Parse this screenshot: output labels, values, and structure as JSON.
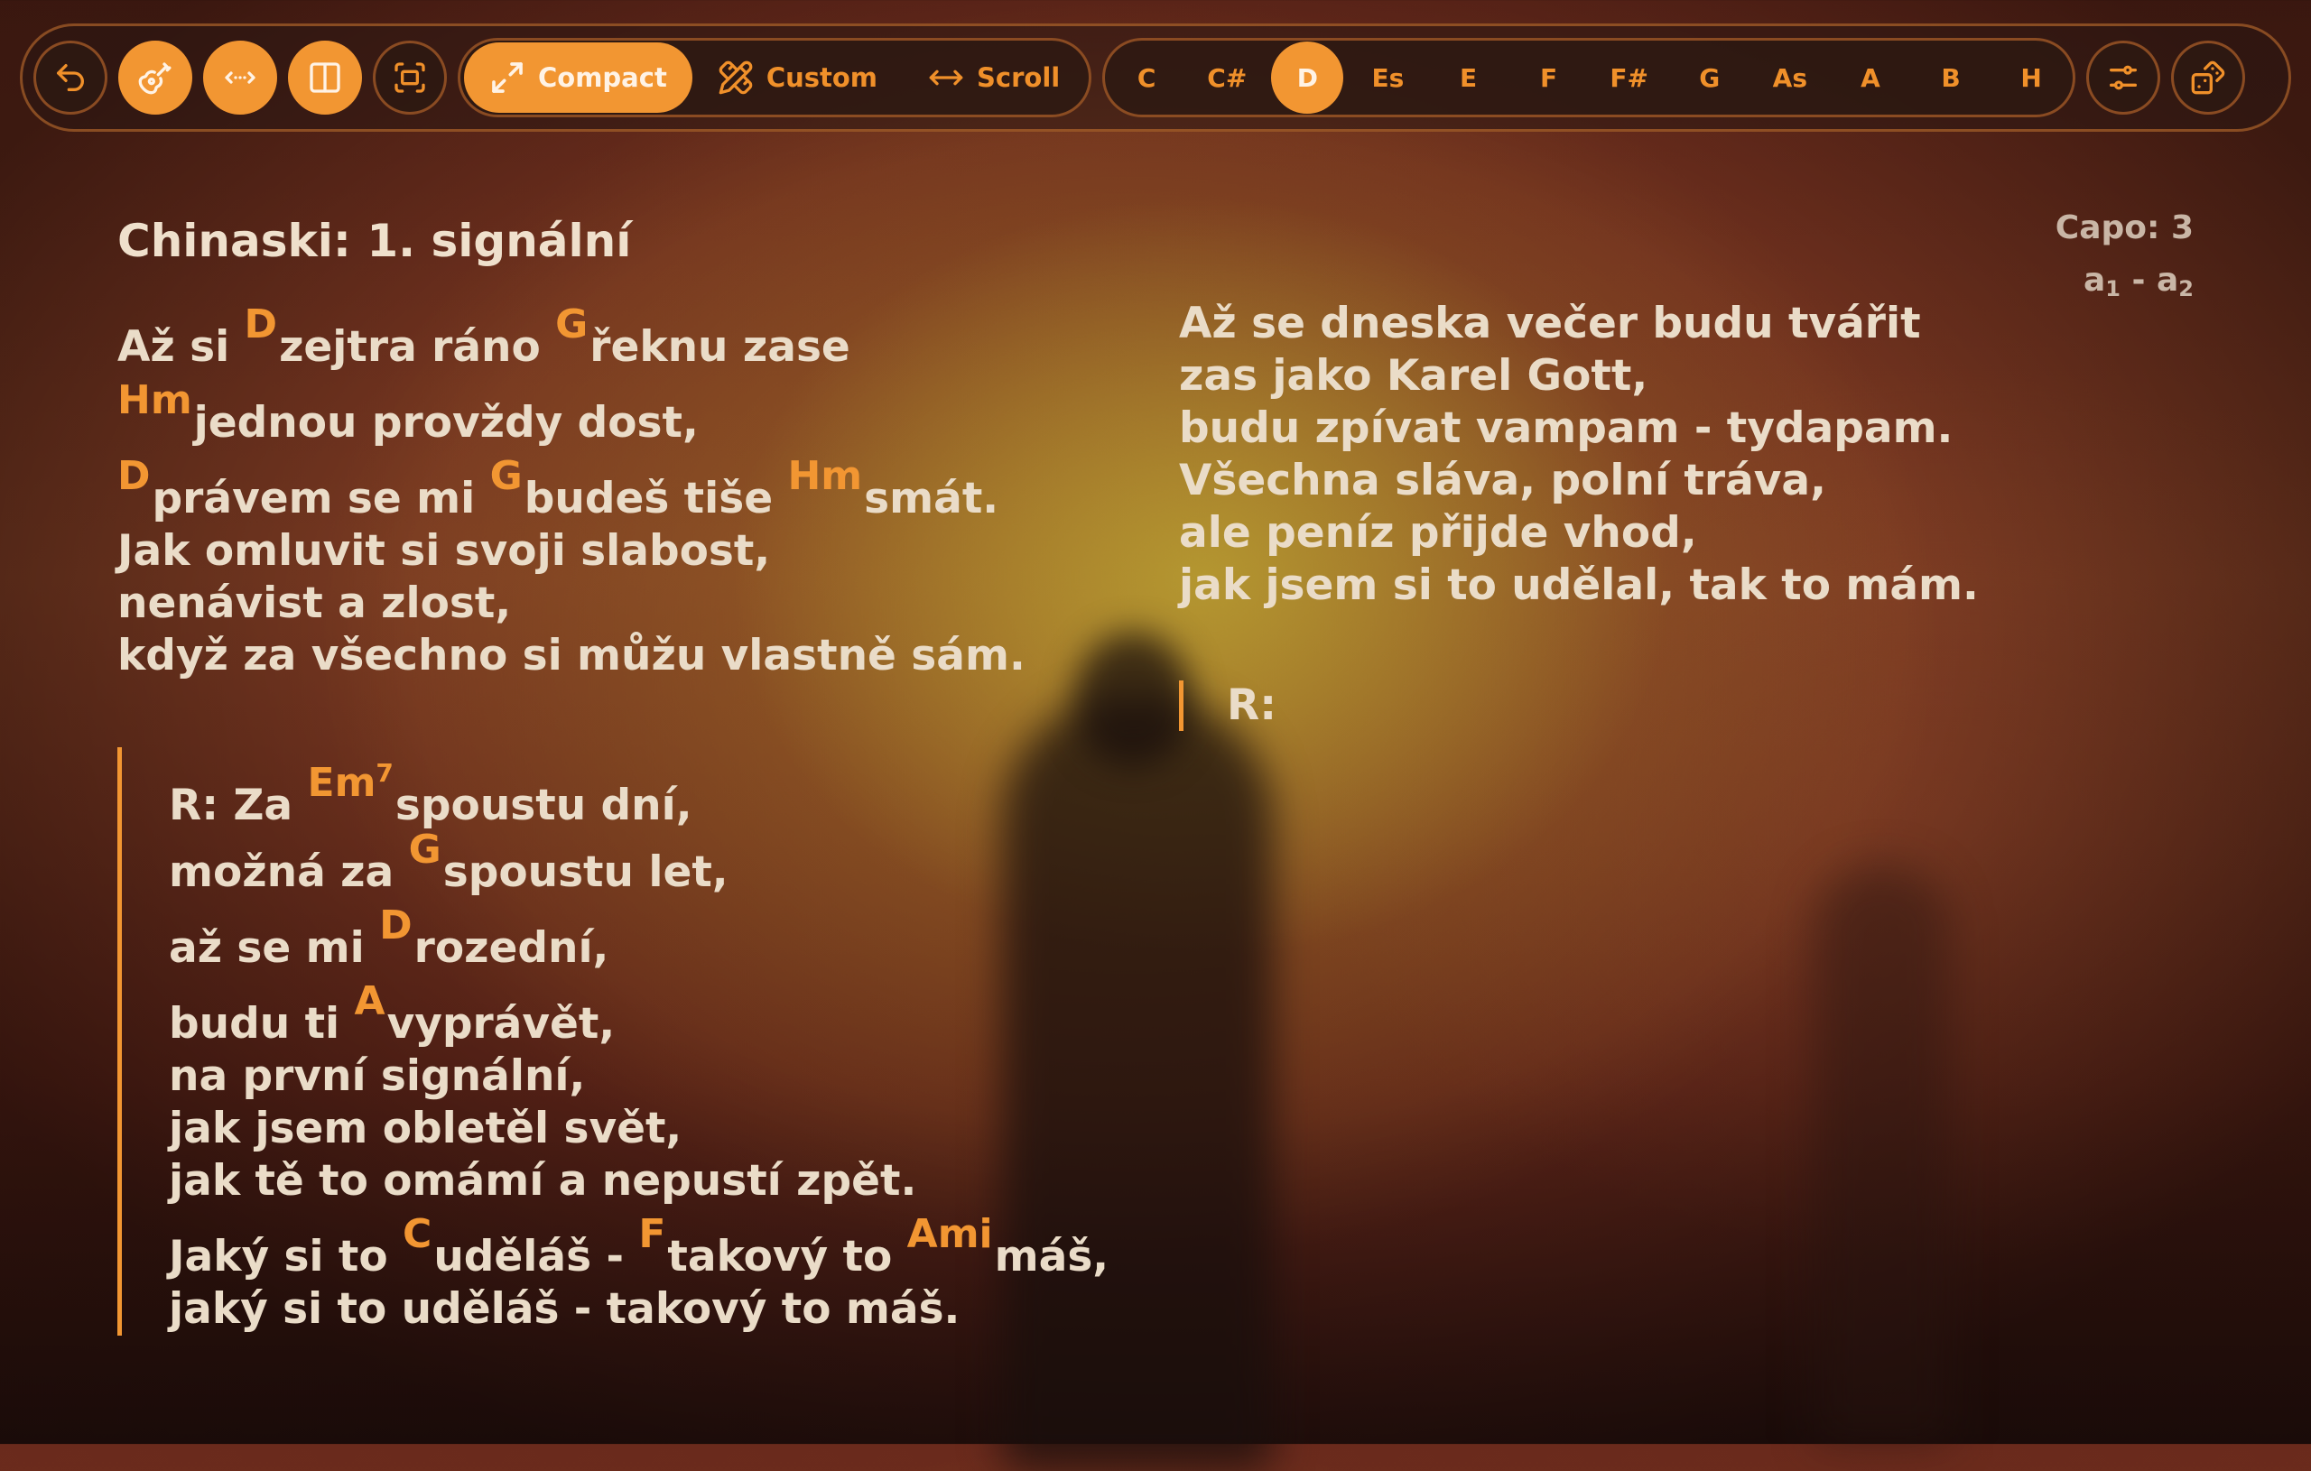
{
  "toolbar": {
    "buttons": [
      {
        "name": "back-button",
        "icon": "undo-arrow-icon",
        "active": false
      },
      {
        "name": "chords-toggle-button",
        "icon": "guitar-icon",
        "active": true
      },
      {
        "name": "width-toggle-button",
        "icon": "expand-horizontal-icon",
        "active": true
      },
      {
        "name": "columns-toggle-button",
        "icon": "two-columns-icon",
        "active": true
      },
      {
        "name": "fit-screen-button",
        "icon": "fit-screen-icon",
        "active": false
      }
    ],
    "modes": [
      {
        "label": "Compact",
        "icon": "diagonal-expand-icon",
        "active": true
      },
      {
        "label": "Custom",
        "icon": "ruler-pencil-icon",
        "active": false
      },
      {
        "label": "Scroll",
        "icon": "horizontal-arrows-icon",
        "active": false
      }
    ],
    "keys": [
      "C",
      "C#",
      "D",
      "Es",
      "E",
      "F",
      "F#",
      "G",
      "As",
      "A",
      "B",
      "H"
    ],
    "selected_key": "D",
    "right_buttons": [
      {
        "name": "settings-button",
        "icon": "sliders-icon"
      },
      {
        "name": "random-song-button",
        "icon": "dice-icon"
      }
    ]
  },
  "song": {
    "title": "Chinaski: 1. signální",
    "capo": "Capo: 3",
    "range_base": "a",
    "range_low": "1",
    "range_sep": " - ",
    "range_high": "2"
  },
  "verse1": [
    {
      "l0": "Až si ",
      "c1": "D",
      "l1": "zejtra ráno ",
      "c2": "G",
      "l2": "řeknu zase"
    },
    {
      "c1": "Hm",
      "l1": "jednou provždy dost,"
    },
    {
      "c1": "D",
      "l1": "právem se mi ",
      "c2": "G",
      "l2": "budeš tiše ",
      "c3": "Hm",
      "l3": "smát."
    },
    {
      "l0": "Jak omluvit si svoji slabost,"
    },
    {
      "l0": "nenávist a zlost,"
    },
    {
      "l0": "když za všechno si můžu vlastně sám."
    }
  ],
  "refrain": [
    {
      "l0": "R: Za ",
      "c1": "Em",
      "c1sup": "7",
      "l1": "spoustu dní,"
    },
    {
      "l0": "možná za ",
      "c1": "G",
      "l1": "spoustu let,"
    },
    {
      "l0": "až se mi ",
      "c1": "D",
      "l1": "rozední,"
    },
    {
      "l0": "budu ti ",
      "c1": "A",
      "l1": "vyprávět,"
    },
    {
      "l0": "na první signální,"
    },
    {
      "l0": "jak jsem obletěl svět,"
    },
    {
      "l0": "jak tě to omámí a nepustí zpět."
    },
    {
      "l0": "Jaký si to ",
      "c1": "C",
      "l1": "uděláš - ",
      "c2": "F",
      "l2": "takový to ",
      "c3": "Ami",
      "l3": "máš,"
    },
    {
      "l0": "jaký si to uděláš - takový to máš."
    }
  ],
  "verse2": [
    "Až se dneska večer budu tvářit",
    "zas jako Karel Gott,",
    "budu zpívat vampam - tydapam.",
    "Všechna sláva, polní tráva,",
    "ale peníz přijde vhod,",
    "jak jsem si to udělal, tak to mám."
  ],
  "refrain_marker": "R:"
}
